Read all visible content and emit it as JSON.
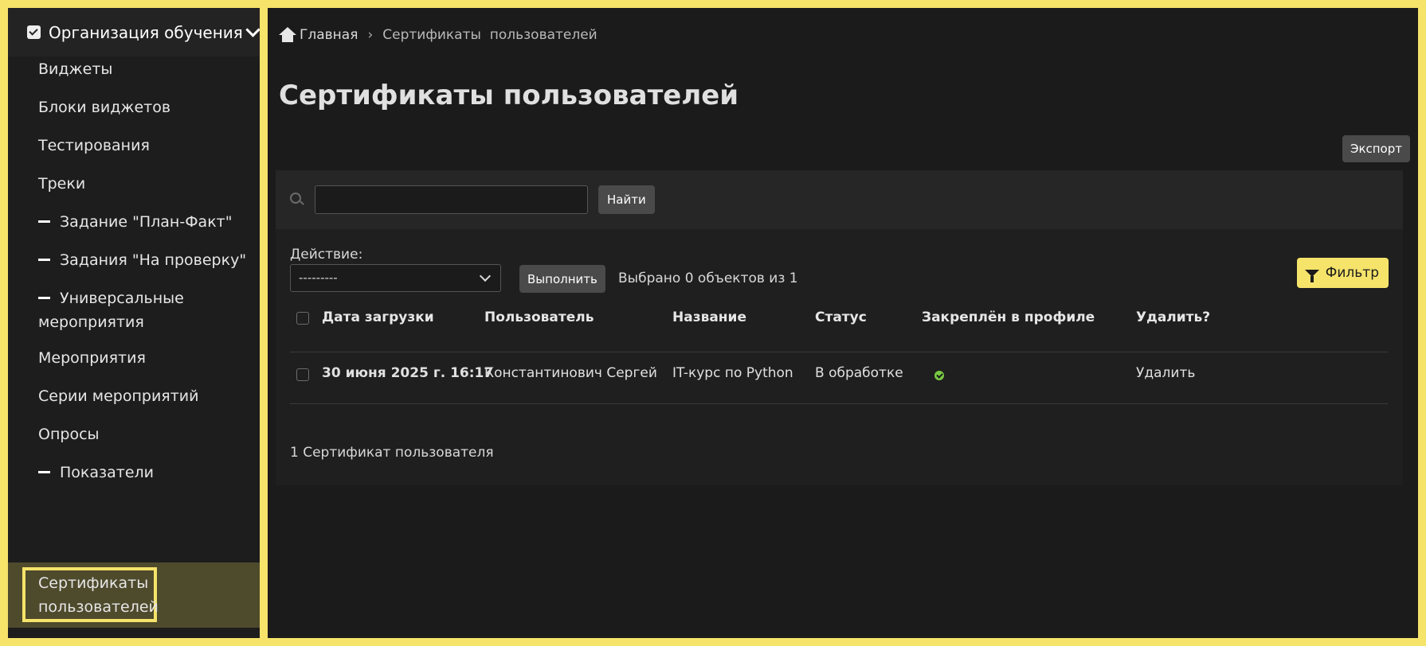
{
  "sidebar": {
    "header": "Организация обучения",
    "items": [
      {
        "label": "Виджеты",
        "sub": false
      },
      {
        "label": "Блоки виджетов",
        "sub": false
      },
      {
        "label": "Тестирования",
        "sub": false
      },
      {
        "label": "Треки",
        "sub": false
      },
      {
        "label": "Задание \"План-Факт\"",
        "sub": true
      },
      {
        "label": "Задания \"На проверку\"",
        "sub": true
      },
      {
        "label": "Универсальные",
        "label2": "мероприятия",
        "sub": true
      },
      {
        "label": "Мероприятия",
        "sub": false
      },
      {
        "label": "Серии мероприятий",
        "sub": false
      },
      {
        "label": "Опросы",
        "sub": false
      },
      {
        "label": "Показатели",
        "sub": true
      }
    ],
    "active": {
      "line1": "Сертификаты",
      "line2": "пользователей"
    }
  },
  "breadcrumb": {
    "home": "Главная",
    "separator": "›",
    "current": "Сертификаты  пользователей"
  },
  "page": {
    "title": "Сертификаты пользователей"
  },
  "toolbar": {
    "export_label": "Экспорт",
    "search_value": "",
    "find_label": "Найти",
    "action_label": "Действие:",
    "action_selected": "---------",
    "run_label": "Выполнить",
    "selected_text": "Выбрано 0 объектов из 1",
    "filter_label": "Фильтр"
  },
  "table": {
    "headers": [
      "Дата загрузки",
      "Пользователь",
      "Название",
      "Статус",
      "Закреплён в профиле",
      "Удалить?"
    ],
    "rows": [
      {
        "date": "30 июня 2025 г. 16:17",
        "user": "Константинович Сергей",
        "name": "IT-курс по Python",
        "status": "В обработке",
        "pinned": "check-circle-icon",
        "delete": "Удалить"
      }
    ]
  },
  "footer": {
    "count_text": "1 Сертификат пользователя"
  },
  "colors": {
    "accent": "#f5e36a",
    "background": "#1b1b1b",
    "sidebar": "#1d1d1d",
    "active_item": "#4e4a2c",
    "success": "#7ac943"
  }
}
